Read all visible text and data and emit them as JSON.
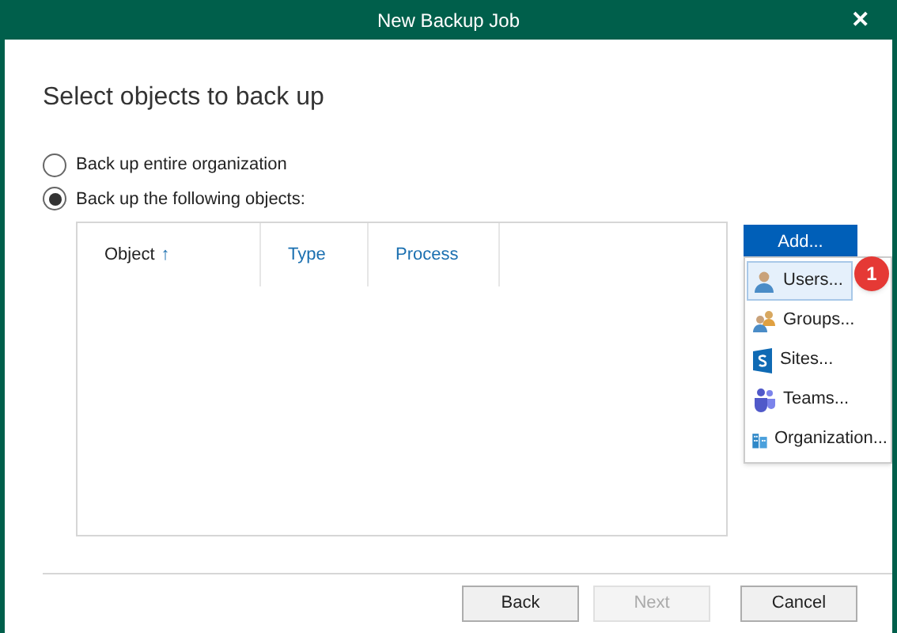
{
  "window": {
    "title": "New Backup Job",
    "close": "✕"
  },
  "heading": "Select objects to back up",
  "options": [
    {
      "label": "Back up entire organization",
      "selected": false
    },
    {
      "label": "Back up the following objects:",
      "selected": true
    }
  ],
  "table": {
    "columns": [
      {
        "label": "Object",
        "sorted": true,
        "arrow": "↑"
      },
      {
        "label": "Type",
        "sorted": false
      },
      {
        "label": "Process",
        "sorted": false
      }
    ]
  },
  "add_button": "Add...",
  "menu": {
    "items": [
      {
        "kind": "user",
        "label": "Users...",
        "selected": true
      },
      {
        "kind": "group",
        "label": "Groups...",
        "selected": false
      },
      {
        "kind": "site",
        "label": "Sites...",
        "selected": false
      },
      {
        "kind": "team",
        "label": "Teams...",
        "selected": false
      },
      {
        "kind": "org",
        "label": "Organization...",
        "selected": false
      }
    ]
  },
  "badge": "1",
  "buttons": [
    {
      "label": "Back",
      "disabled": false
    },
    {
      "label": "Next",
      "disabled": true
    },
    {
      "label": "Cancel",
      "disabled": false
    }
  ]
}
